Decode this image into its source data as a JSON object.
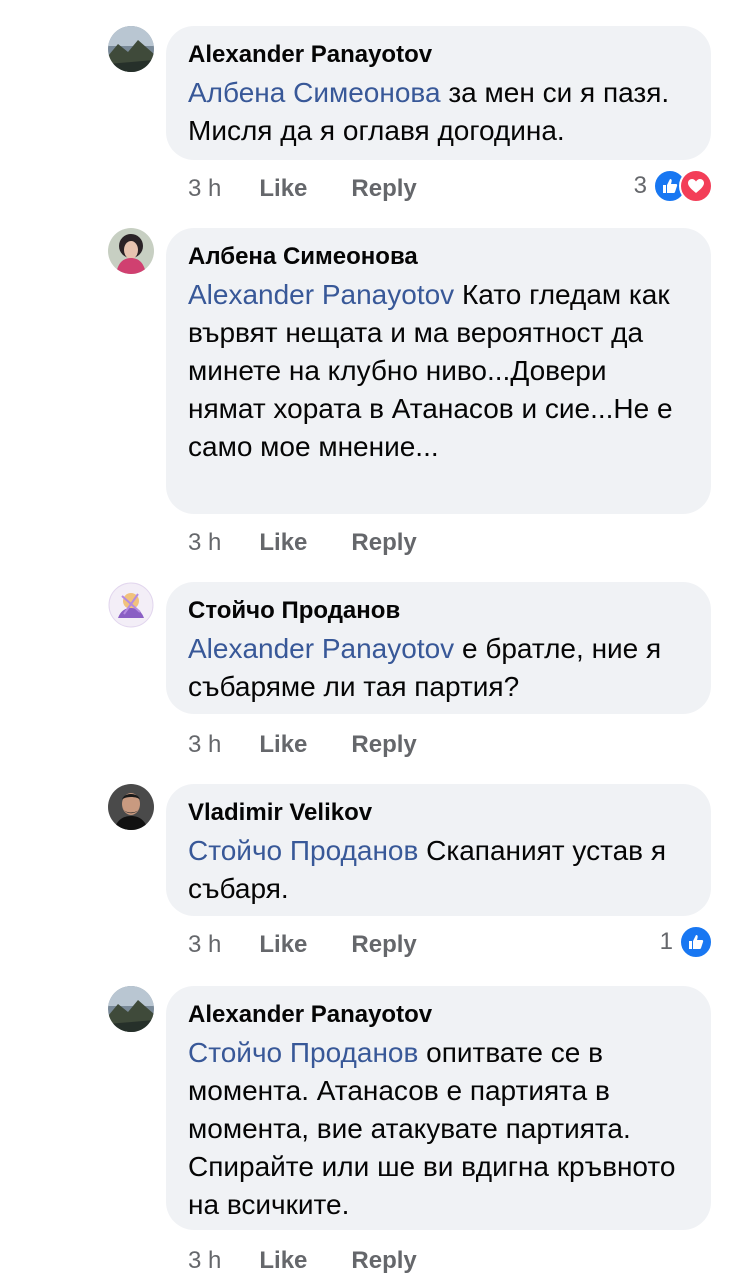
{
  "comments": [
    {
      "author": "Alexander Panayotov",
      "mention": "Албена Симеонова",
      "text": " за мен си я пазя. Мисля да я оглавя догодина.",
      "time": "3 h",
      "like": "Like",
      "reply": "Reply",
      "reaction_count": "3"
    },
    {
      "author": "Албена Симеонова",
      "mention": "Alexander Panayotov",
      "text": "  Като гледам как вървят нещата и ма вероятност да минете на клубно ниво...Довери нямат хората в Атанасов и сие...Не е само мое мнение...",
      "time": "3 h",
      "like": "Like",
      "reply": "Reply"
    },
    {
      "author": "Стойчо Проданов",
      "mention": "Alexander Panayotov",
      "text": " е братле, ние я събаряме ли тая партия?",
      "time": "3 h",
      "like": "Like",
      "reply": "Reply"
    },
    {
      "author": "Vladimir Velikov",
      "mention": "Стойчо Проданов",
      "text": " Скапаният устав я събаря.",
      "time": "3 h",
      "like": "Like",
      "reply": "Reply",
      "reaction_count": "1"
    },
    {
      "author": "Alexander Panayotov",
      "mention": "Стойчо Проданов",
      "text": " опитвате се в момента. Атанасов е партията в момента, вие атакувате партията. Спирайте или ше ви вдигна кръвното на всичките.",
      "time": "3 h",
      "like": "Like",
      "reply": "Reply"
    }
  ],
  "colors": {
    "mention": "#385898",
    "bubble": "#f0f2f5",
    "meta": "#65676b",
    "like_reaction": "#1877f2",
    "love_reaction": "#f33e58"
  }
}
